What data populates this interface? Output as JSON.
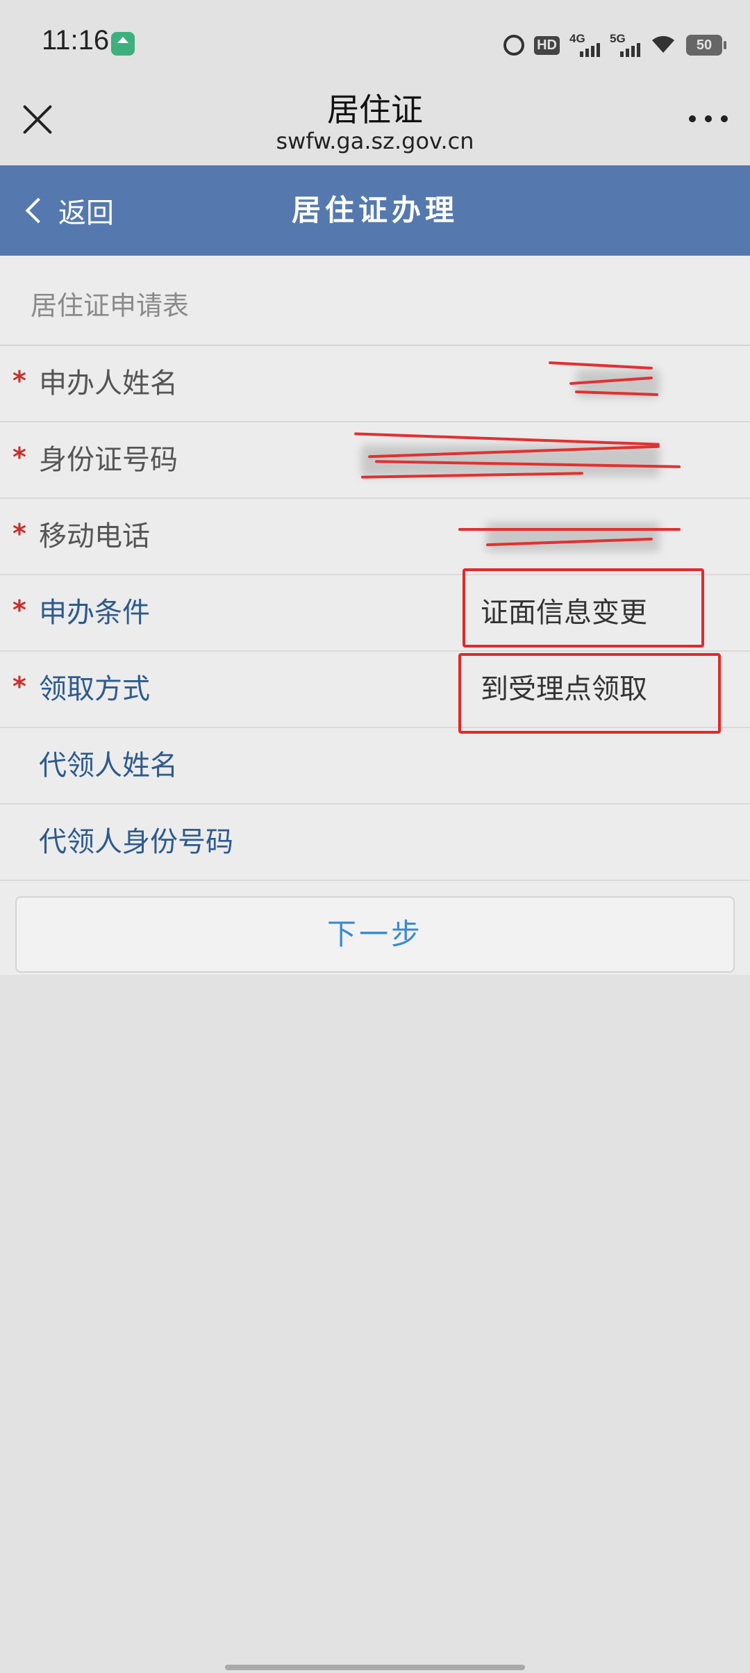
{
  "status_bar": {
    "time": "11:16",
    "hd_label": "HD",
    "net1_label": "4G",
    "net2_label": "5G",
    "battery": "50"
  },
  "nav": {
    "title": "居住证",
    "url": "swfw.ga.sz.gov.cn"
  },
  "header": {
    "back_label": "返回",
    "title": "居住证办理"
  },
  "form": {
    "section_title": "居住证申请表",
    "rows": [
      {
        "label": "申办人姓名",
        "required": "*",
        "value": ""
      },
      {
        "label": "身份证号码",
        "required": "*",
        "value": ""
      },
      {
        "label": "移动电话",
        "required": "*",
        "value": ""
      },
      {
        "label": "申办条件",
        "required": "*",
        "value": "证面信息变更"
      },
      {
        "label": "领取方式",
        "required": "*",
        "value": "到受理点领取"
      },
      {
        "label": "代领人姓名",
        "required": "",
        "value": ""
      },
      {
        "label": "代领人身份号码",
        "required": "",
        "value": ""
      }
    ],
    "next_label": "下一步"
  },
  "colors": {
    "header_bg": "#5579ae",
    "required_star": "#c9302c",
    "label_blue": "#2d5a8e",
    "next_text": "#3a8ad6",
    "annotation_red": "#e02a2a"
  }
}
